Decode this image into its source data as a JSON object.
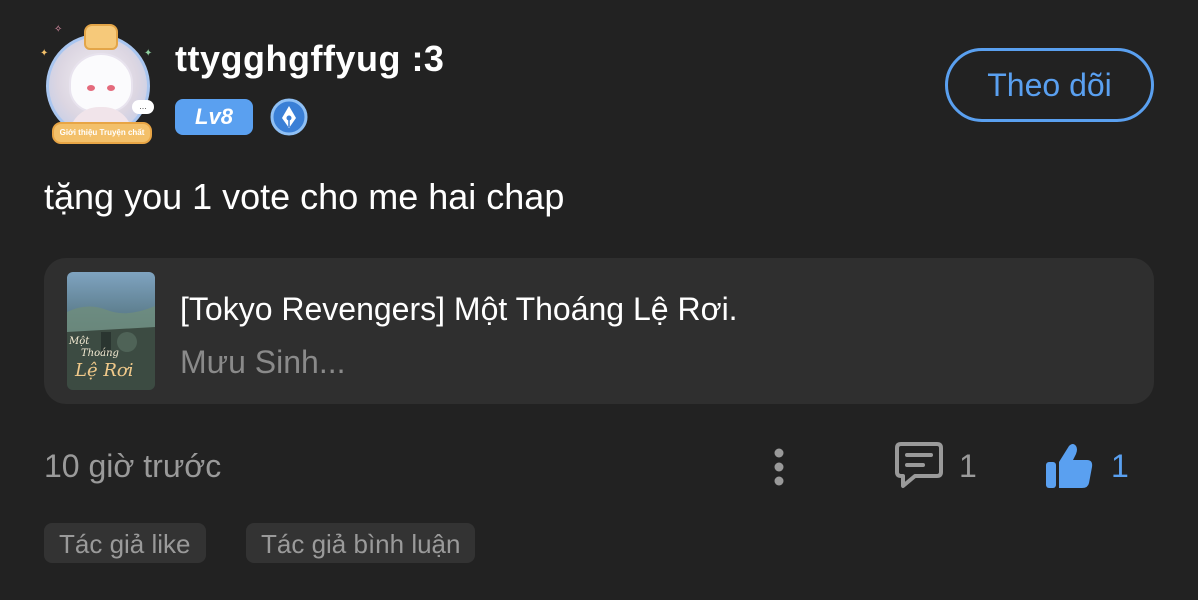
{
  "post": {
    "author": {
      "username": "ttygghgffyug :3",
      "level": "Lv8",
      "avatar_frame_label": "Giới thiệu Truyện chất",
      "avatar_bubble": "...",
      "badge_icon": "pen-nib-icon"
    },
    "follow_label": "Theo dõi",
    "content": "tặng you 1 vote cho me hai chap",
    "linked_story": {
      "title": "[Tokyo Revengers] Một Thoáng Lệ Rơi.",
      "author": "Mưu Sinh...",
      "cover_text_1": "Một",
      "cover_text_2": "Thoáng",
      "cover_text_3": "Lệ Rơi"
    },
    "timestamp": "10 giờ trước",
    "comment_count": "1",
    "like_count": "1",
    "tags": [
      "Tác giả like",
      "Tác giả bình luận"
    ]
  },
  "colors": {
    "background": "#222222",
    "accent": "#5aa0f0",
    "card": "#2f2f2f",
    "muted_text": "#9a9a9a"
  }
}
